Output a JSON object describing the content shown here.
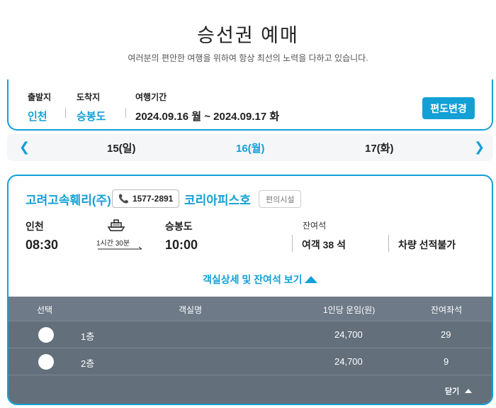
{
  "header": {
    "title": "승선권 예매",
    "subtitle": "여러분의 편안한 여행을 위하여 항상 최선의 노력을 다하고 있습니다."
  },
  "route": {
    "departure_label": "출발지",
    "departure_value": "인천",
    "arrival_label": "도착지",
    "arrival_value": "승봉도",
    "period_label": "여행기간",
    "period_value": "2024.09.16 월 ~ 2024.09.17 화",
    "change_button": "편도변경"
  },
  "date_nav": {
    "prev_icon": "chevron-left",
    "next_icon": "chevron-right",
    "dates": [
      "15(일)",
      "16(월)",
      "17(화)"
    ],
    "active_index": 1,
    "accent_color": "#12a0d7"
  },
  "voyage": {
    "company": "고려고속훼리(주)",
    "phone": "1577-2891",
    "ship_name": "코리아피스호",
    "facility_button": "편의시설",
    "departure_port": "인천",
    "departure_time": "08:30",
    "duration": "1시간 30분",
    "arrival_port": "승봉도",
    "arrival_time": "10:00",
    "remaining_label": "잔여석",
    "passenger_remaining": "여객 38 석",
    "vehicle_status": "차량 선적불가",
    "details_toggle": "객실상세 및 잔여석 보기"
  },
  "seat_table": {
    "headers": [
      "선택",
      "객실명",
      "1인당 운임(원)",
      "잔여좌석"
    ],
    "rows": [
      {
        "room": "1층",
        "fare": "24,700",
        "remaining": "29"
      },
      {
        "room": "2층",
        "fare": "24,700",
        "remaining": "9"
      }
    ],
    "close_label": "닫기"
  }
}
